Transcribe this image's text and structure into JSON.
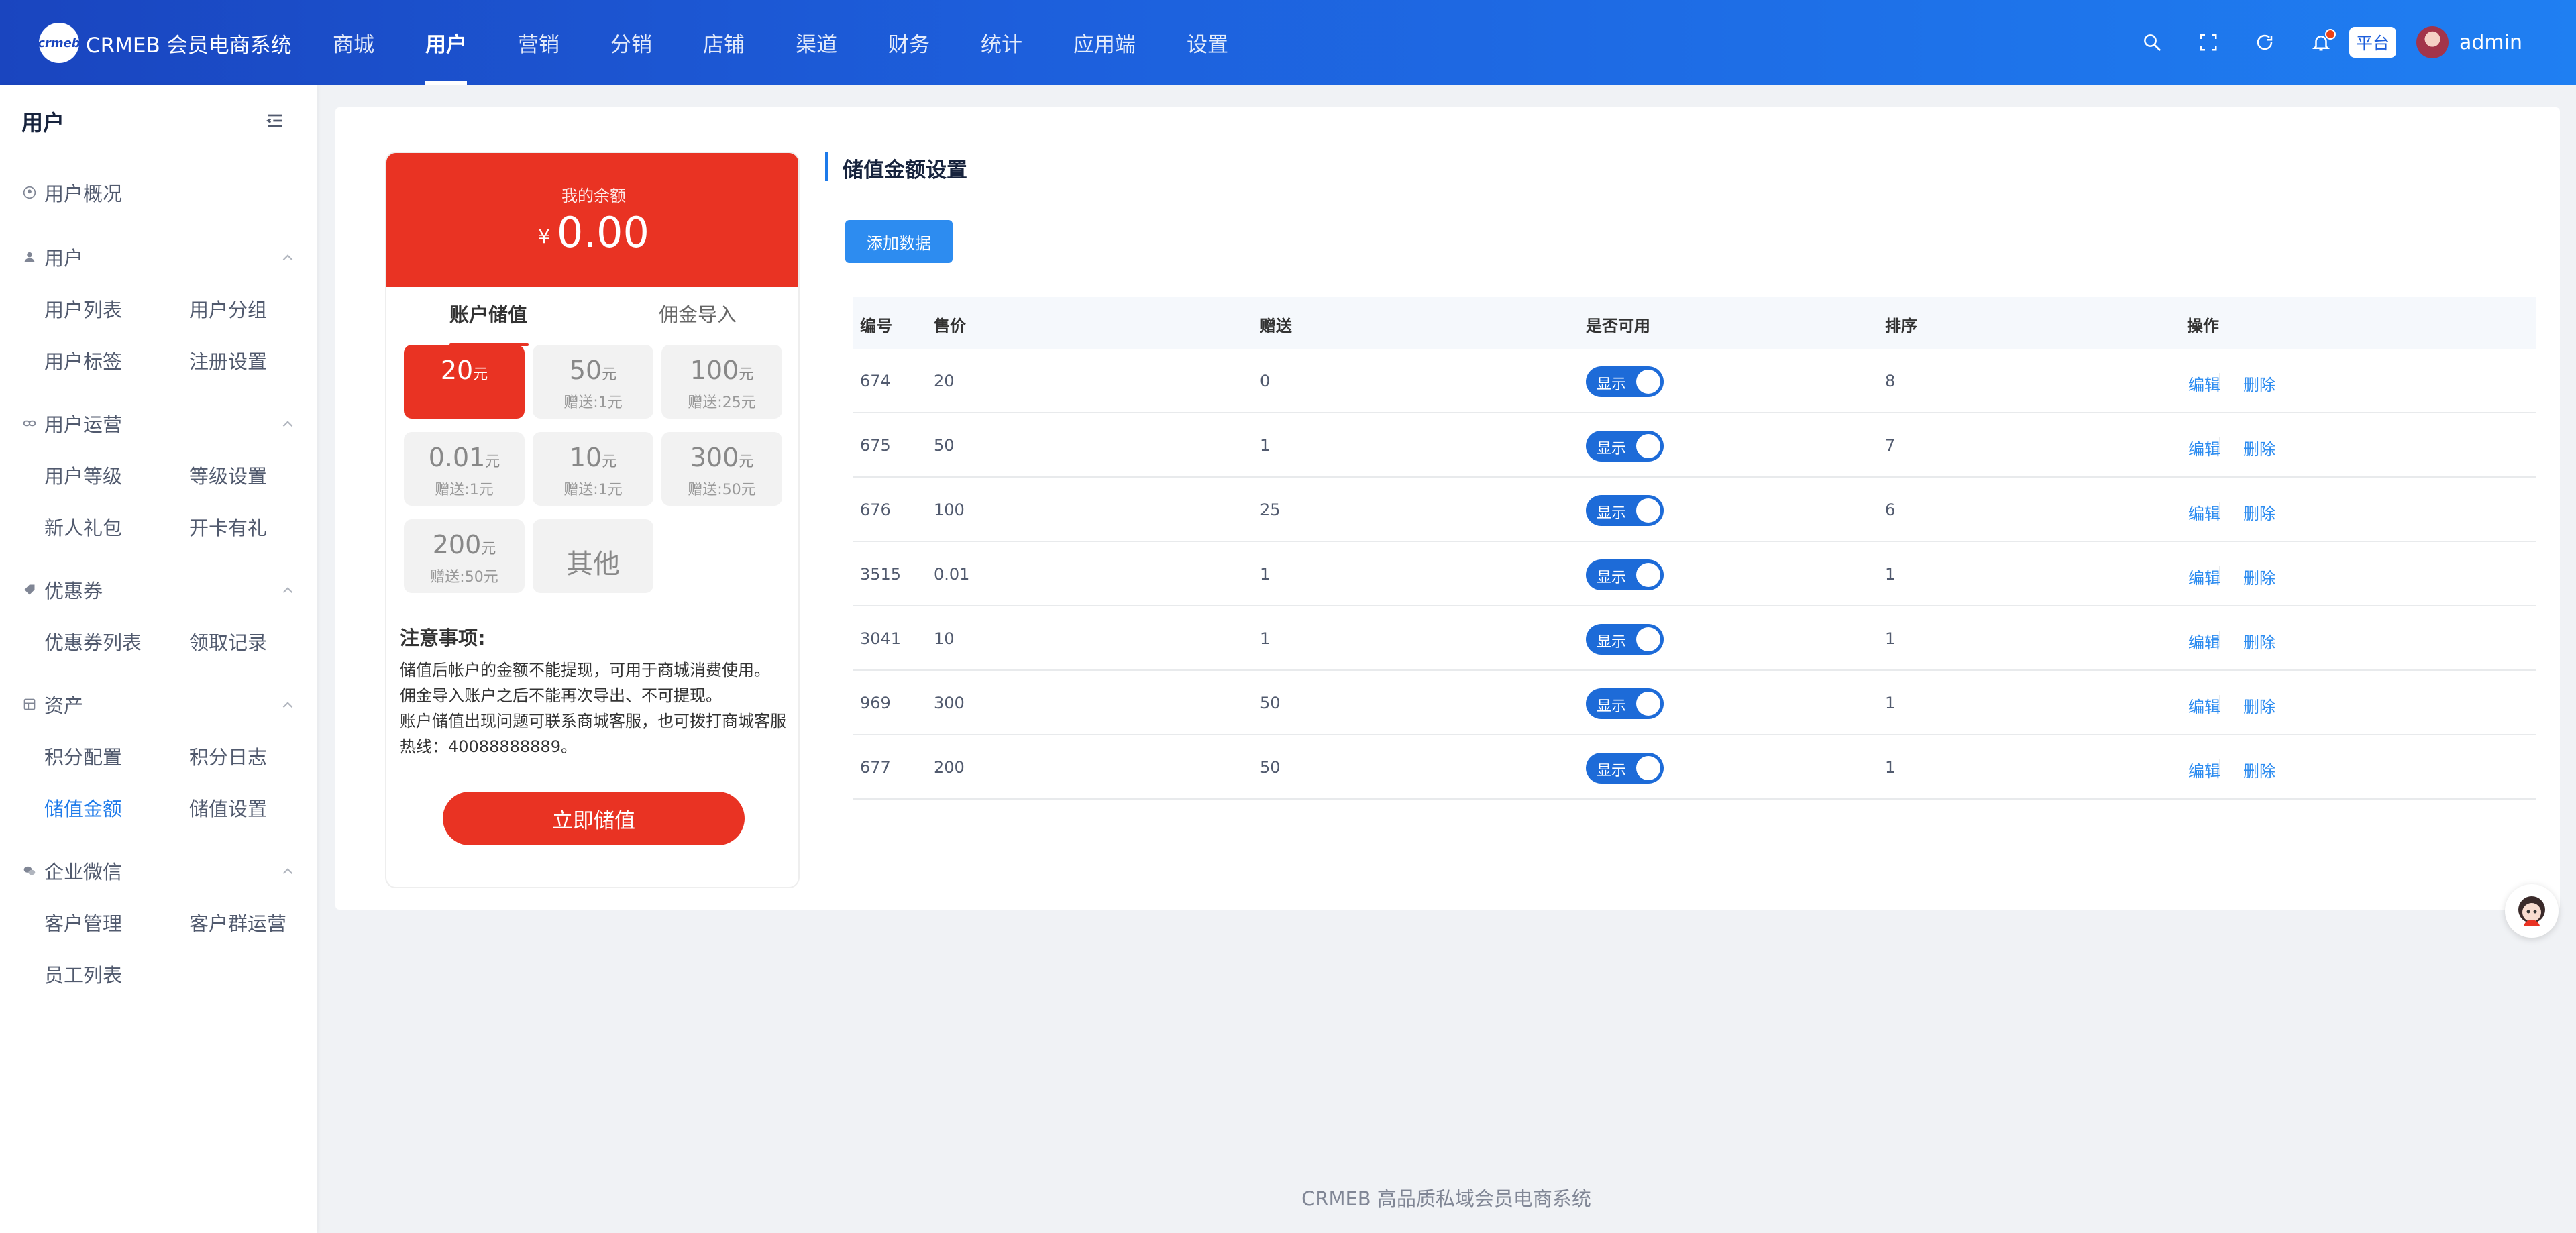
{
  "header": {
    "logo_mark": "crmeb",
    "logo_text": "CRMEB 会员电商系统",
    "nav": [
      "商城",
      "用户",
      "营销",
      "分销",
      "店铺",
      "渠道",
      "财务",
      "统计",
      "应用端",
      "设置"
    ],
    "active_nav": "用户",
    "platform_badge": "平台",
    "user": "admin",
    "icons": [
      "search-icon",
      "fullscreen-icon",
      "refresh-icon",
      "bell-icon"
    ]
  },
  "sidebar": {
    "title": "用户",
    "groups": [
      {
        "title": "用户概况",
        "icon": "user-circle-icon",
        "items": []
      },
      {
        "title": "用户",
        "icon": "user-icon",
        "items": [
          "用户列表",
          "用户分组",
          "用户标签",
          "注册设置"
        ]
      },
      {
        "title": "用户运营",
        "icon": "link-icon",
        "items": [
          "用户等级",
          "等级设置",
          "新人礼包",
          "开卡有礼"
        ]
      },
      {
        "title": "优惠券",
        "icon": "coupon-icon",
        "items": [
          "优惠券列表",
          "领取记录"
        ]
      },
      {
        "title": "资产",
        "icon": "asset-icon",
        "items": [
          "积分配置",
          "积分日志",
          "储值金额",
          "储值设置"
        ]
      },
      {
        "title": "企业微信",
        "icon": "wechat-icon",
        "items": [
          "客户管理",
          "客户群运营",
          "员工列表"
        ]
      }
    ],
    "active_item": "储值金额"
  },
  "recharge": {
    "balance_label": "我的余额",
    "currency": "¥",
    "balance": "0.00",
    "tabs": [
      "账户储值",
      "佣金导入"
    ],
    "unit": "元",
    "amounts": [
      {
        "value": "20",
        "bonus": ""
      },
      {
        "value": "50",
        "bonus": "赠送:1元"
      },
      {
        "value": "100",
        "bonus": "赠送:25元"
      },
      {
        "value": "0.01",
        "bonus": "赠送:1元"
      },
      {
        "value": "10",
        "bonus": "赠送:1元"
      },
      {
        "value": "300",
        "bonus": "赠送:50元"
      },
      {
        "value": "200",
        "bonus": "赠送:50元"
      }
    ],
    "other_label": "其他",
    "notice_title": "注意事项:",
    "notices": [
      "储值后帐户的金额不能提现，可用于商城消费使用。",
      "佣金导入账户之后不能再次导出、不可提现。",
      "账户储值出现问题可联系商城客服，也可拨打商城客服",
      "热线：40088888889。"
    ],
    "button": "立即储值"
  },
  "settings": {
    "title": "储值金额设置",
    "add_button": "添加数据",
    "columns": [
      "编号",
      "售价",
      "赠送",
      "是否可用",
      "排序",
      "操作"
    ],
    "switch_label": "显示",
    "edit": "编辑",
    "delete": "删除",
    "rows": [
      {
        "id": "674",
        "price": "20",
        "bonus": "0",
        "sort": "8"
      },
      {
        "id": "675",
        "price": "50",
        "bonus": "1",
        "sort": "7"
      },
      {
        "id": "676",
        "price": "100",
        "bonus": "25",
        "sort": "6"
      },
      {
        "id": "3515",
        "price": "0.01",
        "bonus": "1",
        "sort": "1"
      },
      {
        "id": "3041",
        "price": "10",
        "bonus": "1",
        "sort": "1"
      },
      {
        "id": "969",
        "price": "300",
        "bonus": "50",
        "sort": "1"
      },
      {
        "id": "677",
        "price": "200",
        "bonus": "50",
        "sort": "1"
      }
    ]
  },
  "footer": "CRMEB 高品质私域会员电商系统",
  "colors": {
    "primary": "#1d7aea",
    "accent_red": "#e93323",
    "header_start": "#1a45bf",
    "header_end": "#1f7ff2"
  }
}
